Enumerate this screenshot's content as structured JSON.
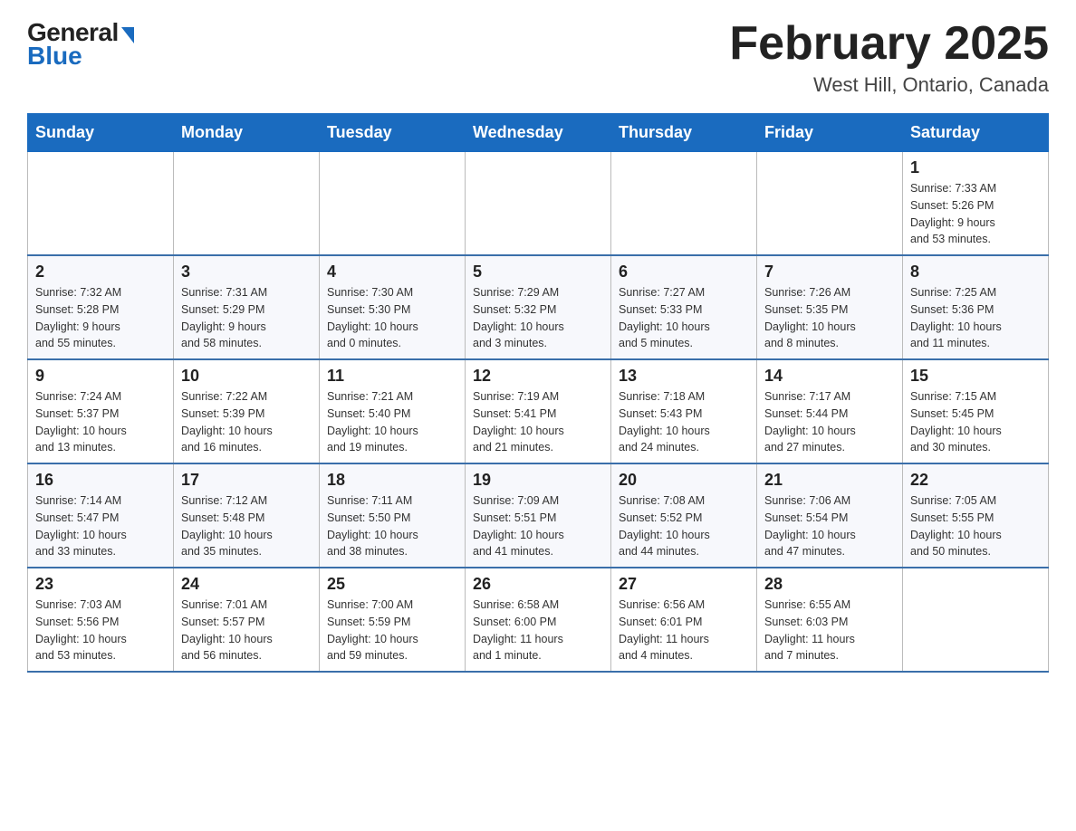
{
  "header": {
    "logo_general": "General",
    "logo_blue": "Blue",
    "month_title": "February 2025",
    "location": "West Hill, Ontario, Canada"
  },
  "days_of_week": [
    "Sunday",
    "Monday",
    "Tuesday",
    "Wednesday",
    "Thursday",
    "Friday",
    "Saturday"
  ],
  "weeks": [
    [
      {
        "num": "",
        "info": ""
      },
      {
        "num": "",
        "info": ""
      },
      {
        "num": "",
        "info": ""
      },
      {
        "num": "",
        "info": ""
      },
      {
        "num": "",
        "info": ""
      },
      {
        "num": "",
        "info": ""
      },
      {
        "num": "1",
        "info": "Sunrise: 7:33 AM\nSunset: 5:26 PM\nDaylight: 9 hours\nand 53 minutes."
      }
    ],
    [
      {
        "num": "2",
        "info": "Sunrise: 7:32 AM\nSunset: 5:28 PM\nDaylight: 9 hours\nand 55 minutes."
      },
      {
        "num": "3",
        "info": "Sunrise: 7:31 AM\nSunset: 5:29 PM\nDaylight: 9 hours\nand 58 minutes."
      },
      {
        "num": "4",
        "info": "Sunrise: 7:30 AM\nSunset: 5:30 PM\nDaylight: 10 hours\nand 0 minutes."
      },
      {
        "num": "5",
        "info": "Sunrise: 7:29 AM\nSunset: 5:32 PM\nDaylight: 10 hours\nand 3 minutes."
      },
      {
        "num": "6",
        "info": "Sunrise: 7:27 AM\nSunset: 5:33 PM\nDaylight: 10 hours\nand 5 minutes."
      },
      {
        "num": "7",
        "info": "Sunrise: 7:26 AM\nSunset: 5:35 PM\nDaylight: 10 hours\nand 8 minutes."
      },
      {
        "num": "8",
        "info": "Sunrise: 7:25 AM\nSunset: 5:36 PM\nDaylight: 10 hours\nand 11 minutes."
      }
    ],
    [
      {
        "num": "9",
        "info": "Sunrise: 7:24 AM\nSunset: 5:37 PM\nDaylight: 10 hours\nand 13 minutes."
      },
      {
        "num": "10",
        "info": "Sunrise: 7:22 AM\nSunset: 5:39 PM\nDaylight: 10 hours\nand 16 minutes."
      },
      {
        "num": "11",
        "info": "Sunrise: 7:21 AM\nSunset: 5:40 PM\nDaylight: 10 hours\nand 19 minutes."
      },
      {
        "num": "12",
        "info": "Sunrise: 7:19 AM\nSunset: 5:41 PM\nDaylight: 10 hours\nand 21 minutes."
      },
      {
        "num": "13",
        "info": "Sunrise: 7:18 AM\nSunset: 5:43 PM\nDaylight: 10 hours\nand 24 minutes."
      },
      {
        "num": "14",
        "info": "Sunrise: 7:17 AM\nSunset: 5:44 PM\nDaylight: 10 hours\nand 27 minutes."
      },
      {
        "num": "15",
        "info": "Sunrise: 7:15 AM\nSunset: 5:45 PM\nDaylight: 10 hours\nand 30 minutes."
      }
    ],
    [
      {
        "num": "16",
        "info": "Sunrise: 7:14 AM\nSunset: 5:47 PM\nDaylight: 10 hours\nand 33 minutes."
      },
      {
        "num": "17",
        "info": "Sunrise: 7:12 AM\nSunset: 5:48 PM\nDaylight: 10 hours\nand 35 minutes."
      },
      {
        "num": "18",
        "info": "Sunrise: 7:11 AM\nSunset: 5:50 PM\nDaylight: 10 hours\nand 38 minutes."
      },
      {
        "num": "19",
        "info": "Sunrise: 7:09 AM\nSunset: 5:51 PM\nDaylight: 10 hours\nand 41 minutes."
      },
      {
        "num": "20",
        "info": "Sunrise: 7:08 AM\nSunset: 5:52 PM\nDaylight: 10 hours\nand 44 minutes."
      },
      {
        "num": "21",
        "info": "Sunrise: 7:06 AM\nSunset: 5:54 PM\nDaylight: 10 hours\nand 47 minutes."
      },
      {
        "num": "22",
        "info": "Sunrise: 7:05 AM\nSunset: 5:55 PM\nDaylight: 10 hours\nand 50 minutes."
      }
    ],
    [
      {
        "num": "23",
        "info": "Sunrise: 7:03 AM\nSunset: 5:56 PM\nDaylight: 10 hours\nand 53 minutes."
      },
      {
        "num": "24",
        "info": "Sunrise: 7:01 AM\nSunset: 5:57 PM\nDaylight: 10 hours\nand 56 minutes."
      },
      {
        "num": "25",
        "info": "Sunrise: 7:00 AM\nSunset: 5:59 PM\nDaylight: 10 hours\nand 59 minutes."
      },
      {
        "num": "26",
        "info": "Sunrise: 6:58 AM\nSunset: 6:00 PM\nDaylight: 11 hours\nand 1 minute."
      },
      {
        "num": "27",
        "info": "Sunrise: 6:56 AM\nSunset: 6:01 PM\nDaylight: 11 hours\nand 4 minutes."
      },
      {
        "num": "28",
        "info": "Sunrise: 6:55 AM\nSunset: 6:03 PM\nDaylight: 11 hours\nand 7 minutes."
      },
      {
        "num": "",
        "info": ""
      }
    ]
  ]
}
